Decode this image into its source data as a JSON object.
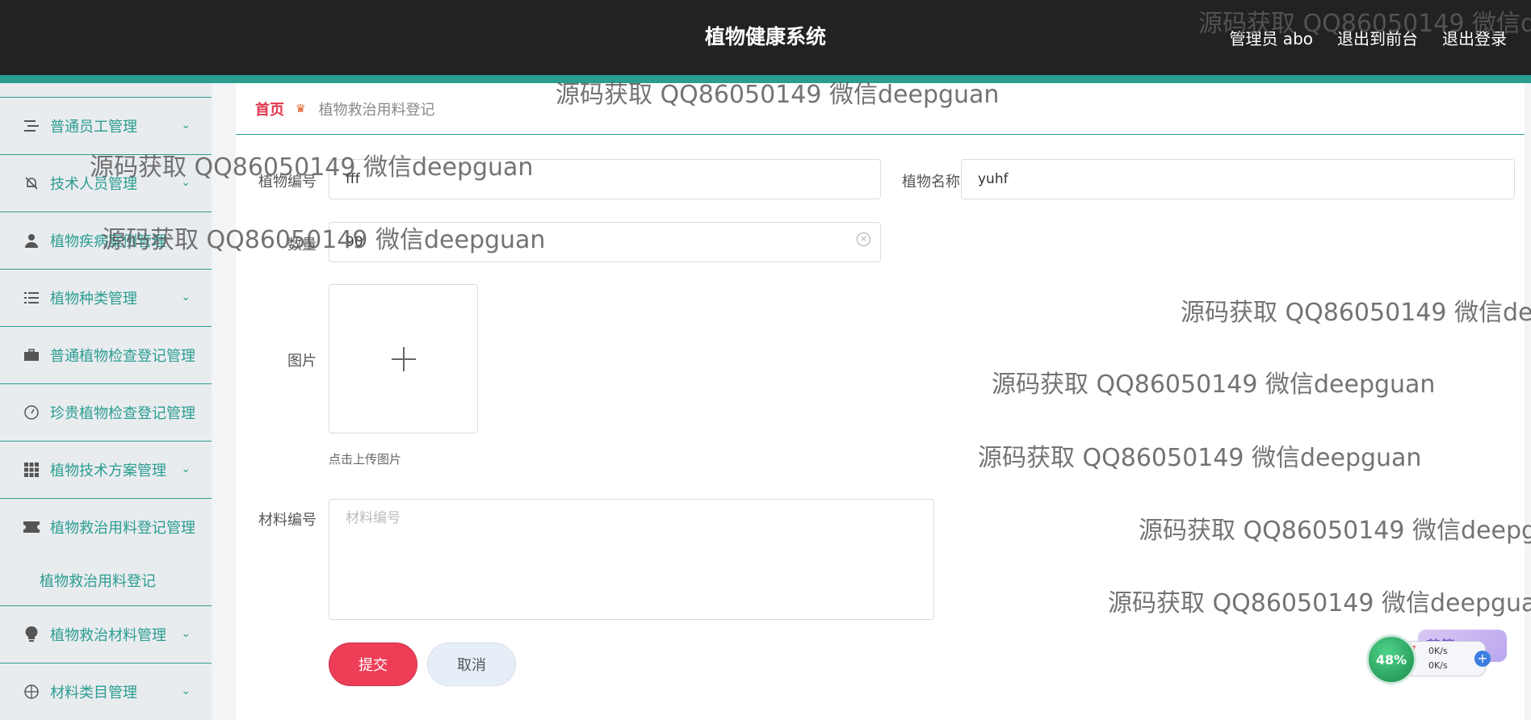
{
  "header": {
    "title": "植物健康系统",
    "admin": "管理员 abo",
    "to_front": "退出到前台",
    "logout": "退出登录"
  },
  "sidebar": {
    "items": [
      {
        "label": "普通员工管理",
        "icon": "list-icon"
      },
      {
        "label": "技术人员管理",
        "icon": "bell-off-icon"
      },
      {
        "label": "植物疾病案例管理",
        "icon": "user-icon"
      },
      {
        "label": "植物种类管理",
        "icon": "list-icon"
      },
      {
        "label": "普通植物检查登记管理",
        "icon": "briefcase-icon"
      },
      {
        "label": "珍贵植物检查登记管理",
        "icon": "gauge-icon"
      },
      {
        "label": "植物技术方案管理",
        "icon": "grid-icon"
      },
      {
        "label": "植物救治用料登记管理",
        "icon": "ticket-icon"
      },
      {
        "label": "植物救治材料管理",
        "icon": "bulb-icon"
      },
      {
        "label": "材料类目管理",
        "icon": "target-icon"
      }
    ],
    "sub_item": "植物救治用料登记"
  },
  "breadcrumb": {
    "home": "首页",
    "current": "植物救治用料登记"
  },
  "form": {
    "plant_code_label": "植物编号",
    "plant_code_value": "fff",
    "plant_name_label": "植物名称",
    "plant_name_value": "yuhf",
    "quantity_label": "数量",
    "quantity_value": "90",
    "image_label": "图片",
    "upload_hint": "点击上传图片",
    "material_code_label": "材料编号",
    "material_code_placeholder": "材料编号",
    "submit": "提交",
    "cancel": "取消"
  },
  "watermark": "源码获取 QQ86050149 微信deepguan",
  "watermark_partial": "源码获取 QQ86050149 微信d",
  "netwidget": {
    "percent": "48%",
    "up": "0K/s",
    "down": "0K/s",
    "tag": "英简"
  }
}
